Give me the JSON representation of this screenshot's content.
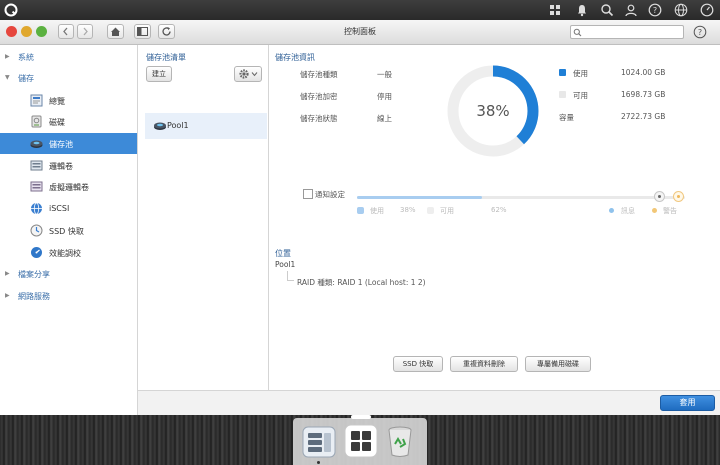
{
  "window": {
    "title": "控制面板",
    "search_placeholder": ""
  },
  "sidebar": {
    "groups": [
      {
        "label": "系統"
      },
      {
        "label": "儲存"
      },
      {
        "label": "檔案分享"
      },
      {
        "label": "網路服務"
      }
    ],
    "storage_items": [
      {
        "label": "總覽",
        "icon": "overview-icon"
      },
      {
        "label": "磁碟",
        "icon": "disk-icon"
      },
      {
        "label": "儲存池",
        "icon": "storage-pool-icon",
        "active": true
      },
      {
        "label": "邏輯卷",
        "icon": "volume-icon"
      },
      {
        "label": "虛擬邏輯卷",
        "icon": "virtual-volume-icon"
      },
      {
        "label": "iSCSI",
        "icon": "iscsi-icon"
      },
      {
        "label": "SSD 快取",
        "icon": "ssd-cache-icon"
      },
      {
        "label": "效能調校",
        "icon": "performance-icon"
      }
    ]
  },
  "pool_panel": {
    "title": "儲存池清單",
    "create_label": "建立",
    "pools": [
      {
        "name": "Pool1"
      }
    ]
  },
  "pool_info": {
    "title": "儲存池資訊",
    "rows": [
      {
        "key": "儲存池種類",
        "value": "一般"
      },
      {
        "key": "儲存池加密",
        "value": "停用"
      },
      {
        "key": "儲存池狀態",
        "value": "線上"
      }
    ],
    "usage_percent": 38,
    "usage_percent_label": "38%",
    "legend": [
      {
        "key": "使用",
        "value": "1024.00 GB",
        "color": "#1f7fd6"
      },
      {
        "key": "可用",
        "value": "1698.73 GB",
        "color": "#e3e3e3"
      },
      {
        "key": "容量",
        "value": "2722.73 GB",
        "color": ""
      }
    ],
    "notify_label": "通知設定",
    "slider_legend": [
      {
        "key": "使用",
        "value": "38%"
      },
      {
        "key": "可用",
        "value": "62%"
      }
    ],
    "thresholds": [
      {
        "label": "訊息",
        "percent": 92
      },
      {
        "label": "警告",
        "percent": 98
      }
    ]
  },
  "location": {
    "title": "位置",
    "pool": "Pool1",
    "raid": "RAID 種類: RAID 1 (Local host: 1 2)"
  },
  "actions": {
    "ssd_cache": "SSD 快取",
    "dedup": "重複資料刪除",
    "dedicated_disk": "專屬備用磁碟"
  },
  "footer": {
    "apply": "套用"
  }
}
